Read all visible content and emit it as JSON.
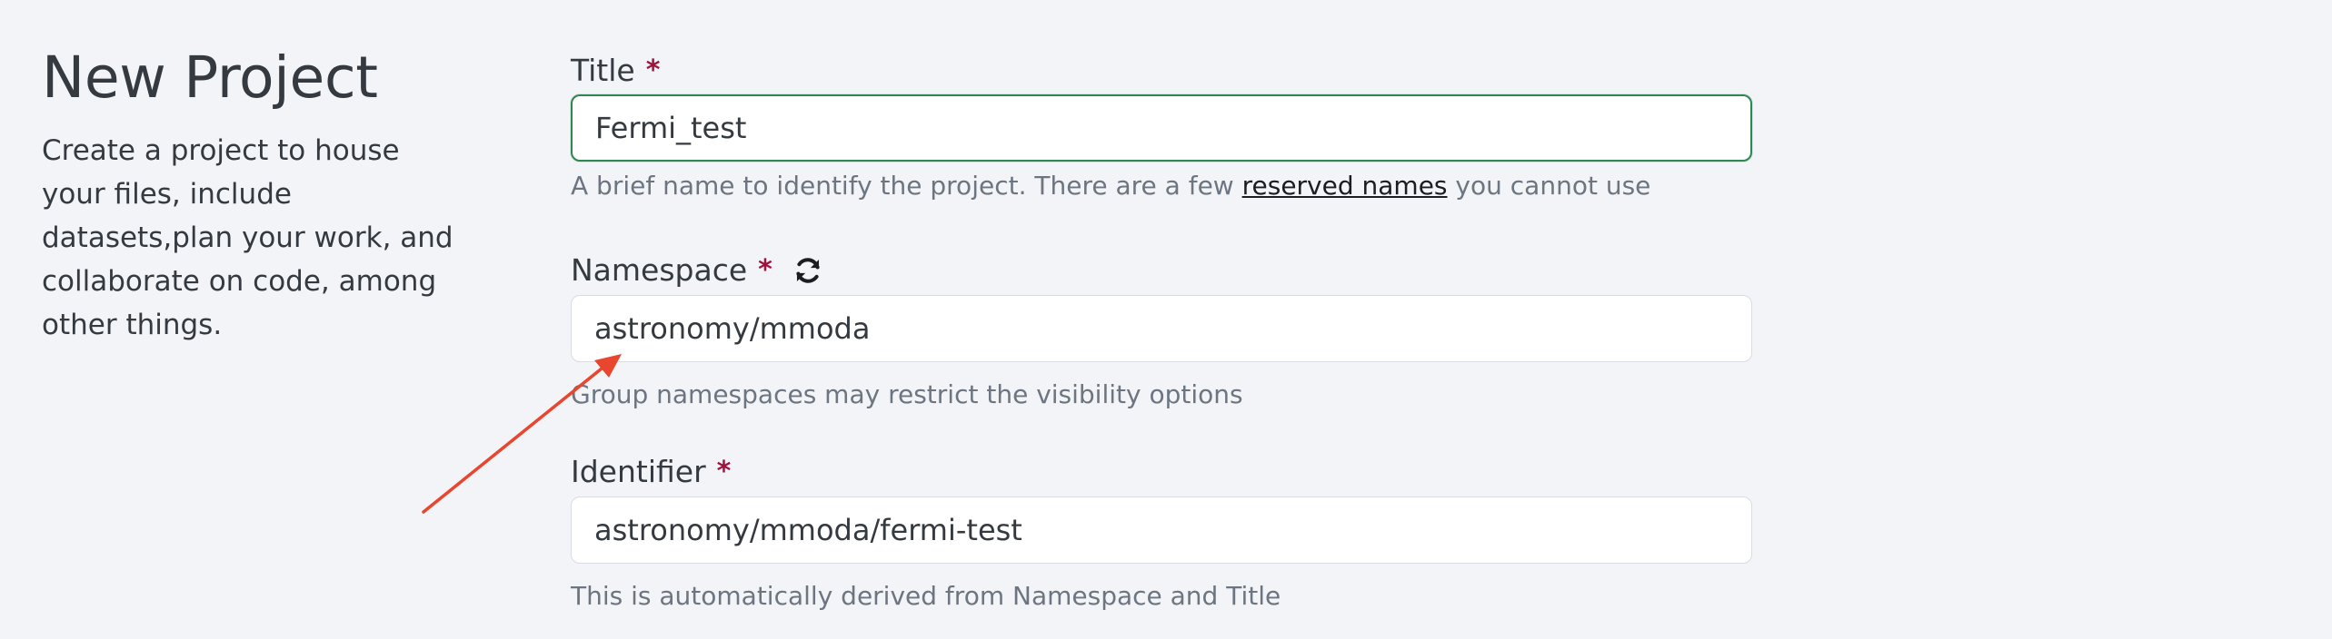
{
  "intro": {
    "title": "New Project",
    "description": "Create a project to house your files, include datasets,plan your work, and collaborate on code, among other things."
  },
  "fields": {
    "title": {
      "label": "Title",
      "required_mark": "*",
      "value": "Fermi_test",
      "help_prefix": "A brief name to identify the project. There are a few ",
      "help_link": "reserved names",
      "help_suffix": " you cannot use"
    },
    "namespace": {
      "label": "Namespace",
      "required_mark": "*",
      "value": "astronomy/mmoda",
      "help": "Group namespaces may restrict the visibility options",
      "refresh_icon": "refresh-icon"
    },
    "identifier": {
      "label": "Identifier",
      "required_mark": "*",
      "value": "astronomy/mmoda/fermi-test",
      "help": "This is automatically derived from Namespace and Title"
    }
  },
  "colors": {
    "focus_border": "#2f8751",
    "required": "#a0123c",
    "annotation_arrow": "#e8462e"
  }
}
